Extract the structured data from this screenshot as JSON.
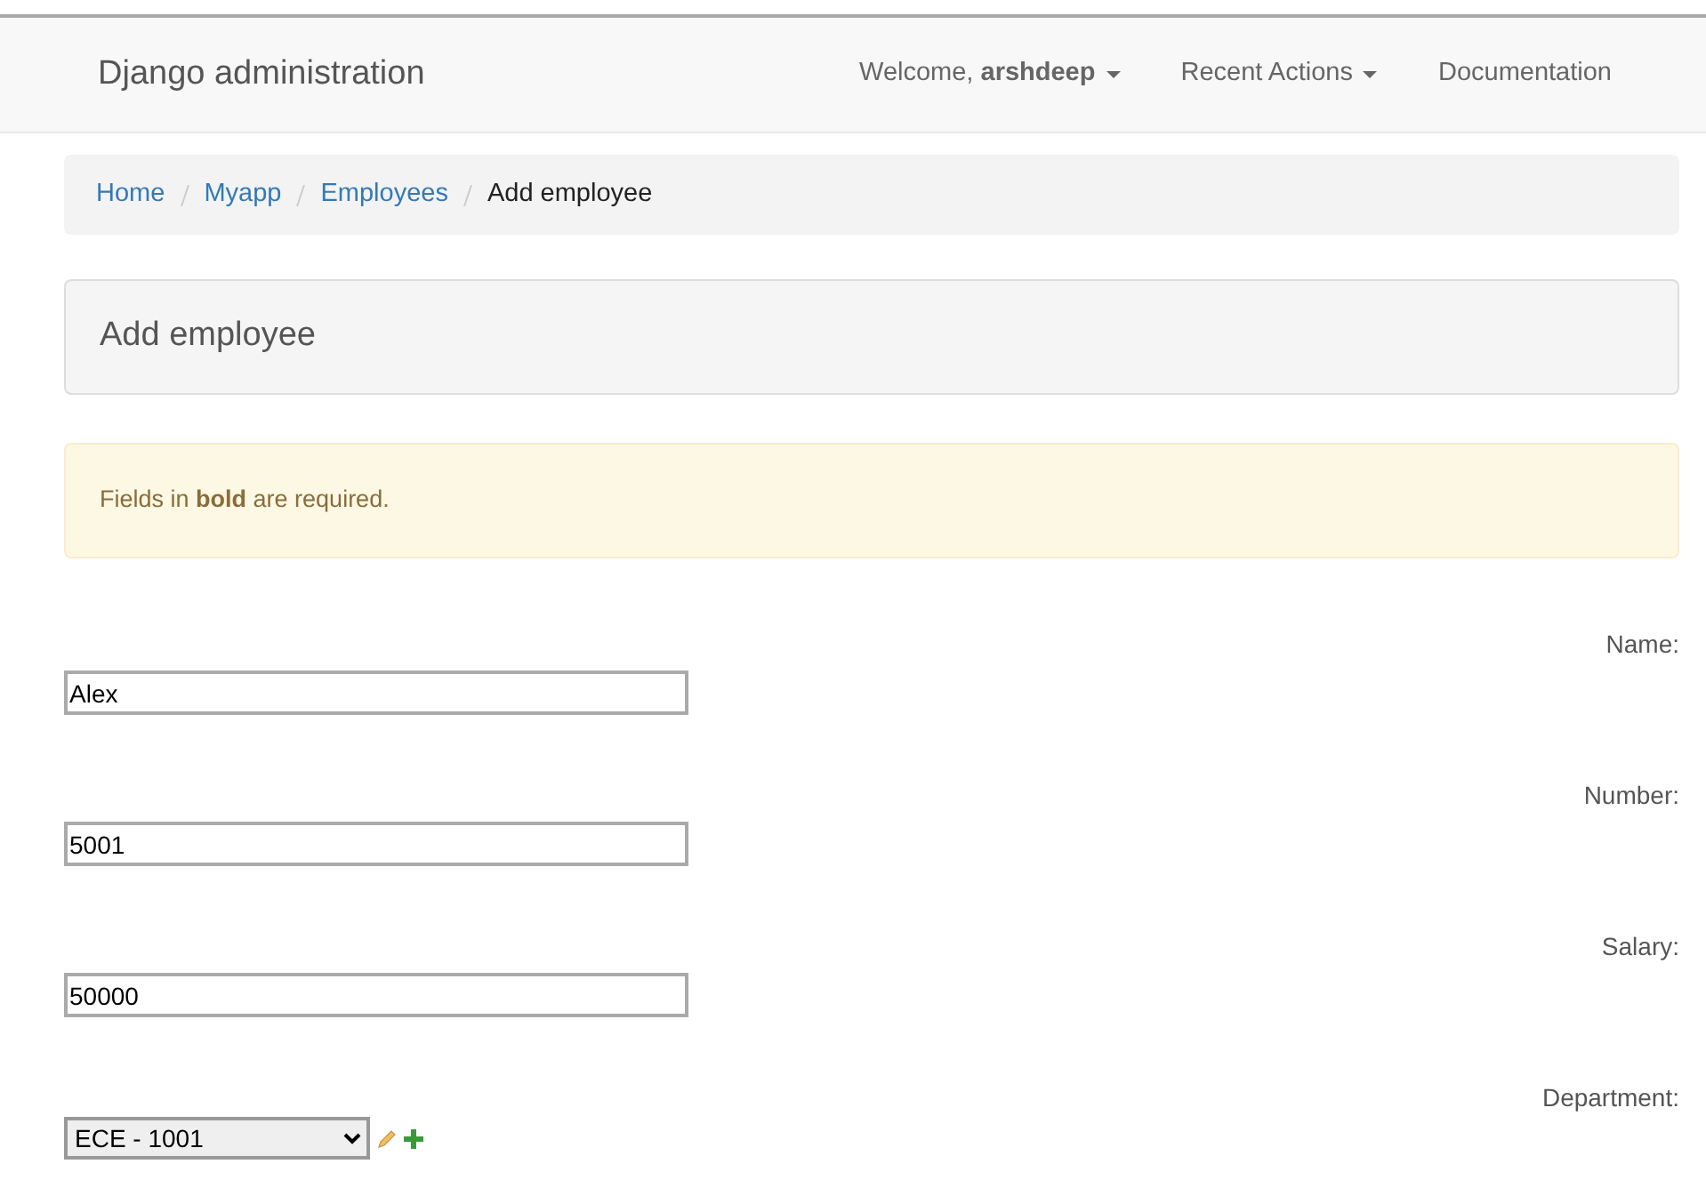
{
  "navbar": {
    "brand": "Django administration",
    "items": [
      {
        "label": "Welcome, **arshdeep**",
        "dropdown": true
      },
      {
        "label": "Recent Actions",
        "dropdown": true
      },
      {
        "label": "Documentation",
        "dropdown": false
      }
    ]
  },
  "breadcrumb": [
    {
      "label": "Home",
      "active": false
    },
    {
      "label": "Myapp",
      "active": false
    },
    {
      "label": "Employees",
      "active": false
    },
    {
      "label": "Add employee",
      "active": true
    }
  ],
  "page_title": "Add employee",
  "alert": "Fields in **bold** are required.",
  "fields": [
    {
      "kind": "text",
      "label": "Name:",
      "value": "Alex"
    },
    {
      "kind": "text",
      "label": "Number:",
      "value": "5001"
    },
    {
      "kind": "text",
      "label": "Salary:",
      "value": "50000"
    },
    {
      "kind": "select",
      "label": "Department:",
      "value": "ECE - 1001"
    }
  ]
}
